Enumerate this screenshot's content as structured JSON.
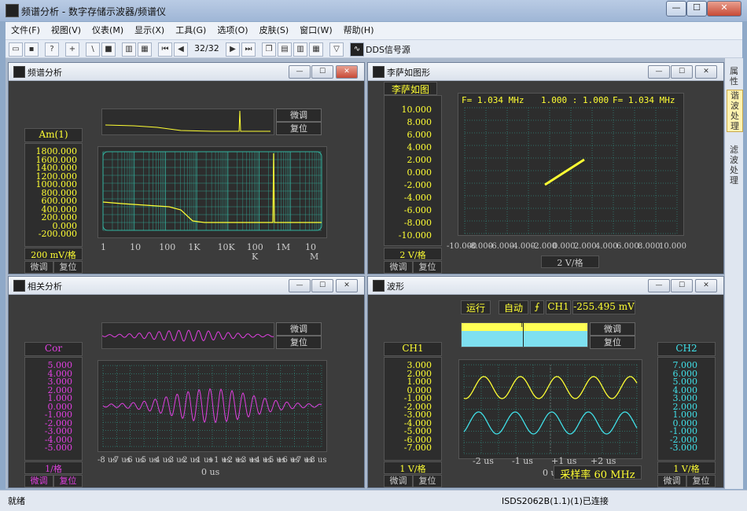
{
  "app": {
    "title": "频谱分析 - 数字存储示波器/频谱仪"
  },
  "window_controls": {
    "minimize": "—",
    "maximize": "☐",
    "close": "✕"
  },
  "menu": [
    "文件(F)",
    "视图(V)",
    "仪表(M)",
    "显示(X)",
    "工具(G)",
    "选项(O)",
    "皮肤(S)",
    "窗口(W)",
    "帮助(H)"
  ],
  "toolbar": {
    "page_counter": "32/32",
    "dds_label": "DDS信号源"
  },
  "dock": {
    "tab1": "属性",
    "tab2": "谐波处理",
    "tab3": "滤波处理"
  },
  "status": {
    "left": "就绪",
    "right": "ISDS2062B(1.1)(1)已连接"
  },
  "panels": {
    "spectrum": {
      "title": "频谱分析",
      "fine_btn": "微调",
      "reset_btn": "复位",
      "y_label": "Am(1)",
      "y_ticks": [
        "1800.000",
        "1600.000",
        "1400.000",
        "1200.000",
        "1000.000",
        "800.000",
        "600.000",
        "400.000",
        "200.000",
        "0.000",
        "-200.000"
      ],
      "x_ticks": [
        "1",
        "10",
        "100",
        "1K",
        "10K",
        "100",
        "1M",
        "10"
      ],
      "x_sub": [
        "K",
        "M"
      ],
      "scale": "200 mV/格",
      "foot": [
        "微调",
        "复位"
      ]
    },
    "lissajous": {
      "title": "李萨如图形",
      "label": "李萨如图",
      "readout": {
        "f1": "F= 1.034 MHz",
        "ratio": "1.000 : 1.000",
        "f2": "F= 1.034 MHz"
      },
      "y_ticks": [
        "10.000",
        "8.000",
        "6.000",
        "4.000",
        "2.000",
        "0.000",
        "-2.000",
        "-4.000",
        "-6.000",
        "-8.000",
        "-10.000"
      ],
      "x_ticks": [
        "-10.000",
        "-8.000",
        "-6.000",
        "-4.000",
        "-2.000",
        "0.000",
        "2.000",
        "4.000",
        "6.000",
        "8.000",
        "10.000"
      ],
      "y_scale": "2 V/格",
      "x_scale": "2 V/格",
      "foot": [
        "微调",
        "复位"
      ]
    },
    "correlation": {
      "title": "相关分析",
      "fine_btn": "微调",
      "reset_btn": "复位",
      "y_label": "Cor",
      "y_ticks": [
        "5.000",
        "4.000",
        "3.000",
        "2.000",
        "1.000",
        "0.000",
        "-1.000",
        "-2.000",
        "-3.000",
        "-4.000",
        "-5.000"
      ],
      "x_ticks": [
        "-8 us",
        "-7 us",
        "-6 us",
        "-5 us",
        "-4 us",
        "-3 us",
        "-2 us",
        "-1 us",
        "+1 us",
        "+2 us",
        "+3 us",
        "+4 us",
        "+5 us",
        "+6 us",
        "+7 us",
        "+8 us"
      ],
      "x_center": "0 us",
      "scale": "1/格",
      "foot": [
        "微调",
        "复位"
      ]
    },
    "waveform": {
      "title": "波形",
      "run": "运行",
      "auto": "自动",
      "trigger_channel": "CH1",
      "trigger_level": "-255.495 mV",
      "fine_btn": "微调",
      "reset_btn": "复位",
      "trig_marker": "T",
      "ch1_label": "CH1",
      "ch2_label": "CH2",
      "ch1_ticks": [
        "3.000",
        "2.000",
        "1.000",
        "0.000",
        "-1.000",
        "-2.000",
        "-3.000",
        "-4.000",
        "-5.000",
        "-6.000",
        "-7.000"
      ],
      "ch2_ticks": [
        "7.000",
        "6.000",
        "5.000",
        "4.000",
        "3.000",
        "2.000",
        "1.000",
        "0.000",
        "-1.000",
        "-2.000",
        "-3.000"
      ],
      "x_ticks": [
        "-2 us",
        "-1 us",
        "+1 us",
        "+2 us"
      ],
      "x_center": "0 us",
      "sample_rate": "采样率  60 MHz",
      "ch1_scale": "1 V/格",
      "ch2_scale": "1 V/格",
      "foot": [
        "微调",
        "复位"
      ]
    }
  },
  "colors": {
    "yellow": "#ffff33",
    "magenta": "#e040e0",
    "cyan": "#40e0e8",
    "grid": "#33b3a0"
  }
}
